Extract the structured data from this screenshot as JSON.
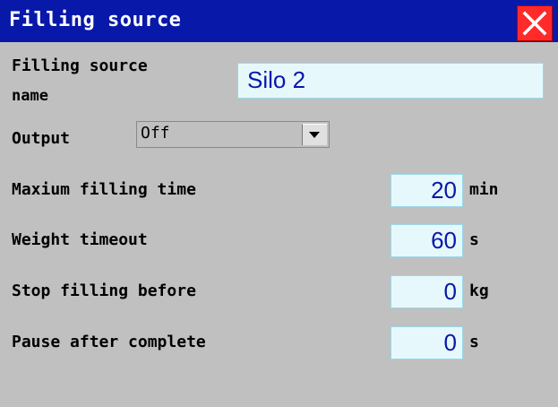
{
  "window": {
    "title": "Filling source",
    "close_icon": "close-icon",
    "colors": {
      "titlebar": "#0818a8",
      "close": "#ff2a2a",
      "background": "#c0c0c0",
      "field": "#e6f8fc",
      "value_text": "#0818a8"
    }
  },
  "source_name": {
    "label_line1": "Filling source",
    "label_line2": "name",
    "value": "Silo 2"
  },
  "output": {
    "label": "Output",
    "selected": "Off",
    "dropdown_icon": "triangle-down-icon"
  },
  "max_filling_time": {
    "label": "Maxium filling time",
    "value": "20",
    "unit": "min"
  },
  "weight_timeout": {
    "label": "Weight timeout",
    "value": "60",
    "unit": "s"
  },
  "stop_before": {
    "label": "Stop filling before",
    "value": "0",
    "unit": "kg"
  },
  "pause_after": {
    "label": "Pause after complete",
    "value": "0",
    "unit": "s"
  }
}
